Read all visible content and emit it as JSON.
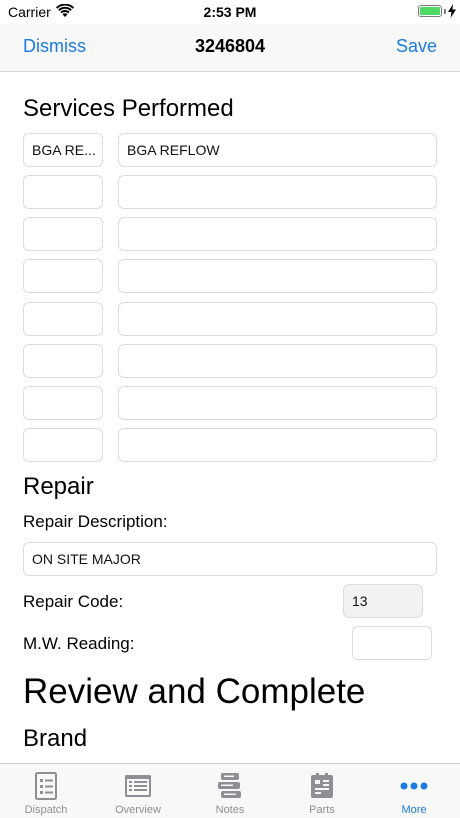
{
  "status_bar": {
    "carrier": "Carrier",
    "time": "2:53 PM"
  },
  "nav": {
    "left": "Dismiss",
    "title": "3246804",
    "right": "Save"
  },
  "services": {
    "heading": "Services Performed",
    "rows": [
      {
        "code": "BGA RE...",
        "description": "BGA REFLOW"
      },
      {
        "code": "",
        "description": ""
      },
      {
        "code": "",
        "description": ""
      },
      {
        "code": "",
        "description": ""
      },
      {
        "code": "",
        "description": ""
      },
      {
        "code": "",
        "description": ""
      },
      {
        "code": "",
        "description": ""
      },
      {
        "code": "",
        "description": ""
      }
    ]
  },
  "repair": {
    "heading": "Repair",
    "description_label": "Repair Description:",
    "description_value": "ON SITE MAJOR",
    "code_label": "Repair Code:",
    "code_value": "13",
    "mw_label": "M.W. Reading:",
    "mw_value": ""
  },
  "review": {
    "heading": "Review and Complete",
    "brand_heading": "Brand"
  },
  "tabs": [
    {
      "label": "Dispatch",
      "icon": "dispatch-icon",
      "active": false
    },
    {
      "label": "Overview",
      "icon": "overview-icon",
      "active": false
    },
    {
      "label": "Notes",
      "icon": "notes-icon",
      "active": false
    },
    {
      "label": "Parts",
      "icon": "parts-icon",
      "active": false
    },
    {
      "label": "More",
      "icon": "more-icon",
      "active": true
    }
  ],
  "colors": {
    "accent": "#1a7be0",
    "inactive": "#8e8e93",
    "battery": "#4cd964"
  }
}
